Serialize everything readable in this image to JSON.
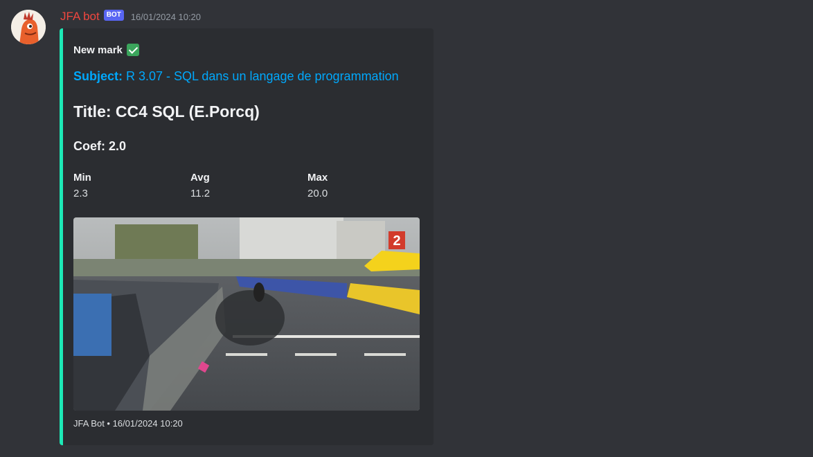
{
  "message": {
    "username": "JFA bot",
    "bot_tag": "BOT",
    "timestamp": "16/01/2024 10:20"
  },
  "embed": {
    "author": "New mark",
    "author_icon": "check-mark-icon",
    "subject_label": "Subject:",
    "subject_value": " R 3.07 - SQL dans un langage de programmation",
    "title": "Title: CC4 SQL (E.Porcq)",
    "coef": "Coef: 2.0",
    "fields": [
      {
        "name": "Min",
        "value": "2.3"
      },
      {
        "name": "Avg",
        "value": "11.2"
      },
      {
        "name": "Max",
        "value": "20.0"
      }
    ],
    "image_overlay_text": "2",
    "footer": "JFA Bot • 16/01/2024 10:20",
    "accent_color": "#1de9b6",
    "link_color": "#00a8fc"
  }
}
